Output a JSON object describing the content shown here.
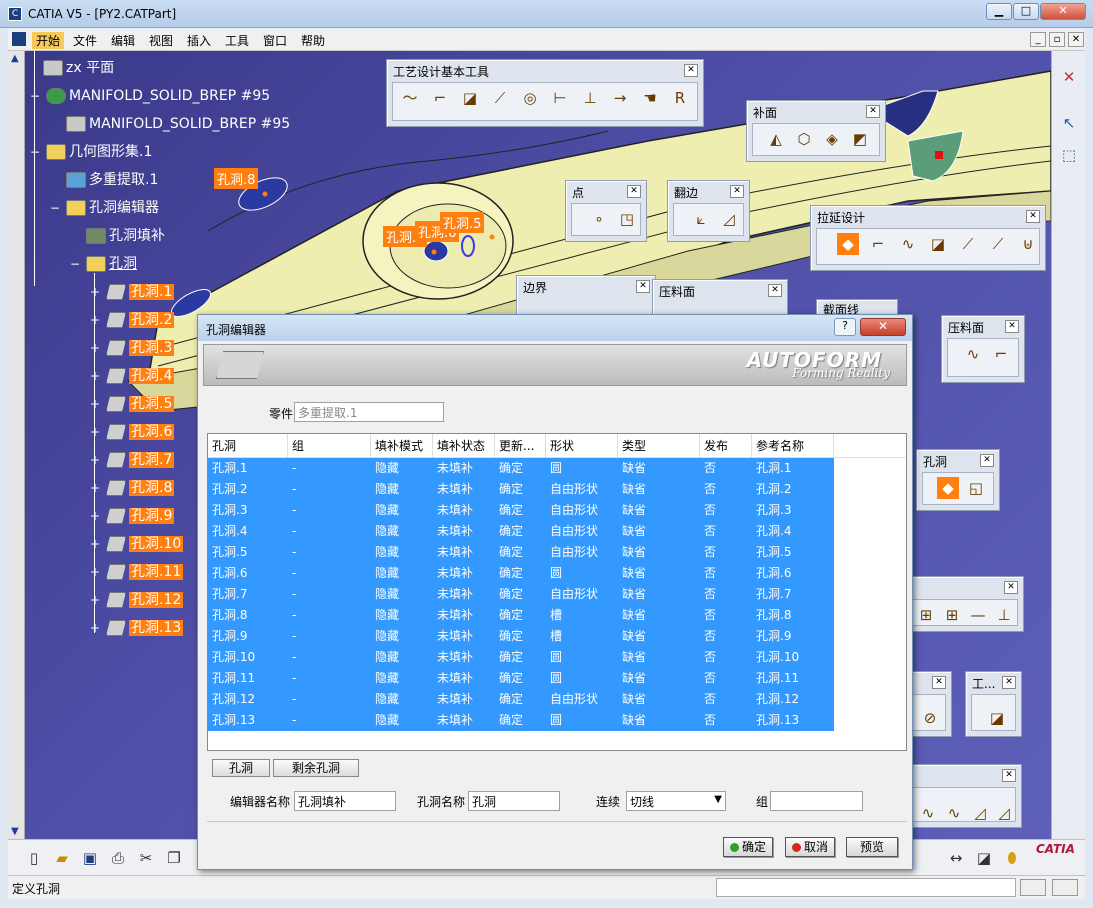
{
  "window": {
    "title": "CATIA V5 - [PY2.CATPart]",
    "btn_min": "▁",
    "btn_max": "□",
    "btn_close": "✕"
  },
  "menu": {
    "items": [
      "开始",
      "文件",
      "编辑",
      "视图",
      "插入",
      "工具",
      "窗口",
      "帮助"
    ]
  },
  "tree": {
    "nodes": [
      {
        "label": "zx 平面",
        "icon": "plane-icon"
      },
      {
        "label": "MANIFOLD_SOLID_BREP #95",
        "icon": "gear-icon"
      },
      {
        "label": "MANIFOLD_SOLID_BREP #95",
        "icon": "surface-icon"
      },
      {
        "label": "几何图形集.1",
        "icon": "folder-icon"
      },
      {
        "label": "多重提取.1",
        "icon": "extract-icon"
      },
      {
        "label": "孔洞编辑器",
        "icon": "folder-icon"
      },
      {
        "label": "孔洞填补",
        "icon": "fill-icon"
      },
      {
        "label": "孔洞",
        "icon": "folder-icon"
      }
    ],
    "holes": [
      "孔洞.1",
      "孔洞.2",
      "孔洞.3",
      "孔洞.4",
      "孔洞.5",
      "孔洞.6",
      "孔洞.7",
      "孔洞.8",
      "孔洞.9",
      "孔洞.10",
      "孔洞.11",
      "孔洞.12",
      "孔洞.13"
    ]
  },
  "viewport_labels": {
    "hole8": "孔洞.8",
    "hole7": "孔洞.7",
    "hole6": "孔洞.6",
    "hole5": "孔洞.5"
  },
  "toolbars": {
    "process_design": "工艺设计基本工具",
    "patch": "补面",
    "point": "点",
    "flange": "翻边",
    "extrude_design": "拉延设计",
    "boundary": "边界",
    "binder1": "压料面",
    "binder2": "压料面",
    "section": "截面线",
    "hole": "孔洞",
    "small_tool": "工..."
  },
  "dialog": {
    "title": "孔洞编辑器",
    "help": "?",
    "close": "✕",
    "brand": "AUTOFORM",
    "brand_tagline": "Forming Reality",
    "part_label": "零件",
    "part_value": "多重提取.1",
    "columns": [
      "孔洞",
      "组",
      "填补模式",
      "填补状态",
      "更新...",
      "形状",
      "类型",
      "发布",
      "参考名称"
    ],
    "rows": [
      [
        "孔洞.1",
        "-",
        "隐藏",
        "未填补",
        "确定",
        "圆",
        "缺省",
        "否",
        "孔洞.1"
      ],
      [
        "孔洞.2",
        "-",
        "隐藏",
        "未填补",
        "确定",
        "自由形状",
        "缺省",
        "否",
        "孔洞.2"
      ],
      [
        "孔洞.3",
        "-",
        "隐藏",
        "未填补",
        "确定",
        "自由形状",
        "缺省",
        "否",
        "孔洞.3"
      ],
      [
        "孔洞.4",
        "-",
        "隐藏",
        "未填补",
        "确定",
        "自由形状",
        "缺省",
        "否",
        "孔洞.4"
      ],
      [
        "孔洞.5",
        "-",
        "隐藏",
        "未填补",
        "确定",
        "自由形状",
        "缺省",
        "否",
        "孔洞.5"
      ],
      [
        "孔洞.6",
        "-",
        "隐藏",
        "未填补",
        "确定",
        "圆",
        "缺省",
        "否",
        "孔洞.6"
      ],
      [
        "孔洞.7",
        "-",
        "隐藏",
        "未填补",
        "确定",
        "自由形状",
        "缺省",
        "否",
        "孔洞.7"
      ],
      [
        "孔洞.8",
        "-",
        "隐藏",
        "未填补",
        "确定",
        "槽",
        "缺省",
        "否",
        "孔洞.8"
      ],
      [
        "孔洞.9",
        "-",
        "隐藏",
        "未填补",
        "确定",
        "槽",
        "缺省",
        "否",
        "孔洞.9"
      ],
      [
        "孔洞.10",
        "-",
        "隐藏",
        "未填补",
        "确定",
        "圆",
        "缺省",
        "否",
        "孔洞.10"
      ],
      [
        "孔洞.11",
        "-",
        "隐藏",
        "未填补",
        "确定",
        "圆",
        "缺省",
        "否",
        "孔洞.11"
      ],
      [
        "孔洞.12",
        "-",
        "隐藏",
        "未填补",
        "确定",
        "自由形状",
        "缺省",
        "否",
        "孔洞.12"
      ],
      [
        "孔洞.13",
        "-",
        "隐藏",
        "未填补",
        "确定",
        "圆",
        "缺省",
        "否",
        "孔洞.13"
      ]
    ],
    "tab_holes": "孔洞",
    "tab_remaining": "剩余孔洞",
    "editor_name_label": "编辑器名称",
    "editor_name_value": "孔洞填补",
    "hole_name_label": "孔洞名称",
    "hole_name_value": "孔洞",
    "continuity_label": "连续",
    "continuity_value": "切线",
    "group_label": "组",
    "group_value": "",
    "ok": "确定",
    "cancel": "取消",
    "preview": "预览"
  },
  "status": {
    "text": "定义孔洞"
  },
  "brand_logo": "CATIA",
  "colors": {
    "selection": "#3399ff",
    "highlight": "#ff7f11",
    "part": "#f0f0b0",
    "background": "#4a4aa0"
  }
}
